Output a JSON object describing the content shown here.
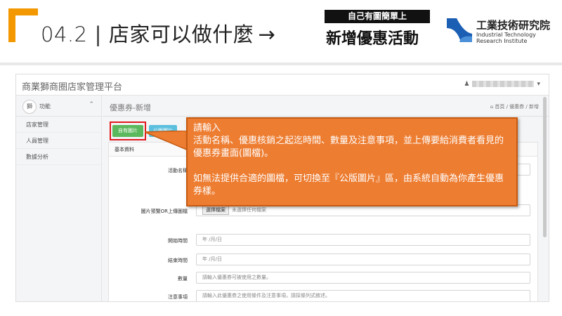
{
  "slide": {
    "section_number": "04.2",
    "title_main": "店家可以做什麼",
    "arrow": "→",
    "badge": "自己有圖簡單上",
    "subtitle": "新增優惠活動",
    "accent_color": "#f39800",
    "logo": {
      "name_zh": "工業技術研究院",
      "name_en_line1": "Industrial Technology",
      "name_en_line2": "Research Institute",
      "color": "#1a5fb4"
    }
  },
  "app": {
    "brand": "商業獅商圈店家管理平台",
    "user_icon": "user-icon",
    "sidebar": {
      "header_badge": "獅",
      "header_label": "功能",
      "items": [
        {
          "label": "店家管理"
        },
        {
          "label": "人員管理"
        },
        {
          "label": "數據分析"
        }
      ]
    },
    "page_heading": "優惠券-新增",
    "breadcrumb": "首頁 / 優惠券 / 新增",
    "buttons": {
      "own_image": "自有圖片",
      "public_image": "公版圖片"
    },
    "panel_title": "基本資料",
    "form": {
      "activity_name": {
        "label": "活動名稱",
        "value": ""
      },
      "image_upload": {
        "label": "圖片預覽OR上傳圖檔",
        "button": "選擇檔案",
        "status": "未選擇任何檔案"
      },
      "start_time": {
        "label": "開始時間",
        "placeholder": "年 /月/日"
      },
      "end_time": {
        "label": "結束時間",
        "placeholder": "年 /月/日"
      },
      "quantity": {
        "label": "數量",
        "placeholder": "請輸入優惠券可被使用之數量。"
      },
      "notes": {
        "label": "注意事項",
        "placeholder": "請輸入此優惠券之使用條件及注意事項，請採條列式敘述。"
      }
    }
  },
  "callout": {
    "line1": "請輸入",
    "line2": "活動名稱、優惠核銷之起迄時間、數量及注意事項，並上傳要給消費者看見的優惠券畫面(圖檔)。",
    "line3": "如無法提供合適的圖檔，可切換至『公版圖片』區，由系統自動為你產生優惠券樣。",
    "fill_color": "#ed7d31",
    "highlight_color": "#e0191d"
  }
}
